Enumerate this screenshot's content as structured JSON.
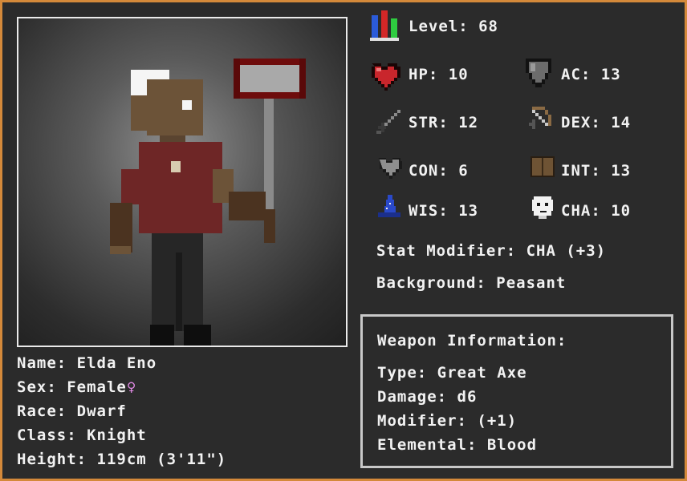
{
  "colors": {
    "frame": "#d4893a",
    "background": "#2b2b2b",
    "text": "#f2f2f2",
    "female_symbol": "#e28be6"
  },
  "level": {
    "label": "Level:",
    "value": "68",
    "icon": "level-bars-icon"
  },
  "stats": {
    "hp": {
      "label": "HP:",
      "value": "10",
      "icon": "heart-icon"
    },
    "ac": {
      "label": "AC:",
      "value": "13",
      "icon": "shield-icon"
    },
    "str": {
      "label": "STR:",
      "value": "12",
      "icon": "sword-icon"
    },
    "dex": {
      "label": "DEX:",
      "value": "14",
      "icon": "bow-icon"
    },
    "con": {
      "label": "CON:",
      "value": "6",
      "icon": "grey-heart-icon"
    },
    "int": {
      "label": "INT:",
      "value": "13",
      "icon": "book-icon"
    },
    "wis": {
      "label": "WIS:",
      "value": "13",
      "icon": "wizard-hat-icon"
    },
    "cha": {
      "label": "CHA:",
      "value": "10",
      "icon": "mask-icon"
    }
  },
  "stat_modifier": "Stat Modifier: CHA (+3)",
  "background": "Background: Peasant",
  "character": {
    "name": "Name: Elda Eno",
    "sex": "Sex: Female",
    "sex_symbol": "♀",
    "race": "Race: Dwarf",
    "class": "Class: Knight",
    "height": "Height: 119cm (3'11\")"
  },
  "weapon": {
    "title": "Weapon Information:",
    "type": "Type: Great Axe",
    "damage": "Damage: d6",
    "modifier": "Modifier: (+1)",
    "elemental": "Elemental: Blood"
  }
}
